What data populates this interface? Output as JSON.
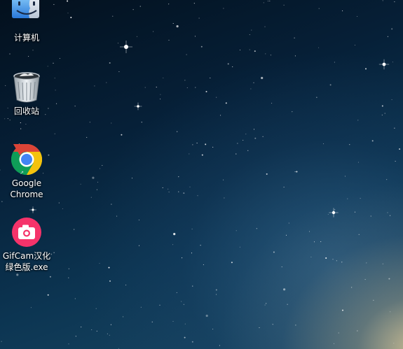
{
  "desktop": {
    "icons": [
      {
        "label": "计算机",
        "icon": "finder-computer-icon"
      },
      {
        "label": "回收站",
        "icon": "recycle-bin-icon"
      },
      {
        "label_line1": "Google",
        "label_line2": "Chrome",
        "icon": "chrome-icon"
      },
      {
        "label_line1": "GifCam汉化",
        "label_line2": "绿色版.exe",
        "icon": "camera-icon"
      }
    ]
  },
  "colors": {
    "chrome_red": "#db4437",
    "chrome_yellow": "#f4c20d",
    "chrome_green": "#0f9d58",
    "chrome_blue": "#4285f4",
    "gifcam_pink": "#f5336a"
  }
}
